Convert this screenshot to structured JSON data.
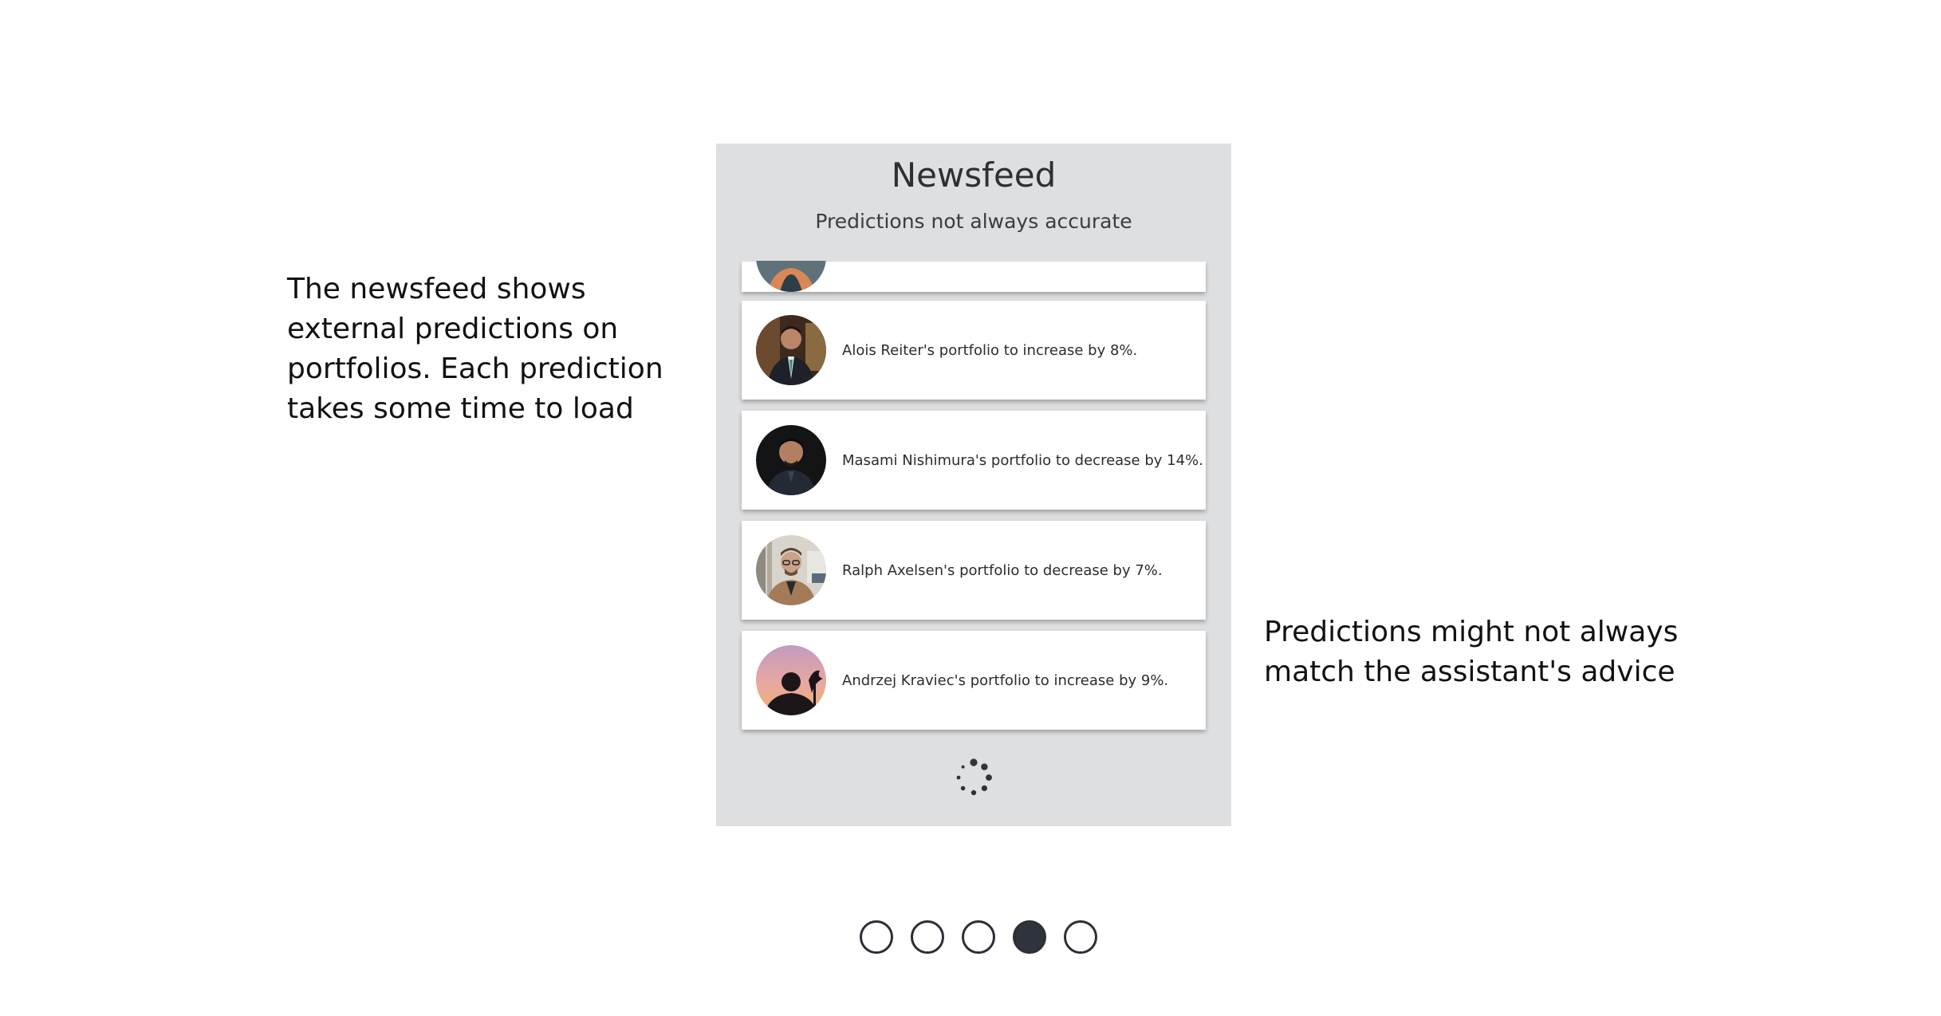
{
  "annotations": {
    "left": "The newsfeed shows external predictions on portfolios. Each prediction takes some time to load",
    "right": "Predictions might not always match the assistant's advice"
  },
  "newsfeed": {
    "title": "Newsfeed",
    "subtitle": "Predictions not always accurate",
    "items": [
      {
        "text": ""
      },
      {
        "text": "Alois Reiter's portfolio to increase by 8%."
      },
      {
        "text": "Masami Nishimura's portfolio to decrease by 14%."
      },
      {
        "text": "Ralph Axelsen's portfolio to decrease by 7%."
      },
      {
        "text": "Andrzej Kraviec's portfolio to increase by 9%."
      }
    ]
  },
  "pager": {
    "total": 5,
    "active_index": 3
  },
  "colors": {
    "panel_bg": "#dedfe0",
    "card_bg": "#ffffff",
    "dot_border": "#2c2f36",
    "dot_active": "#2f333b"
  }
}
